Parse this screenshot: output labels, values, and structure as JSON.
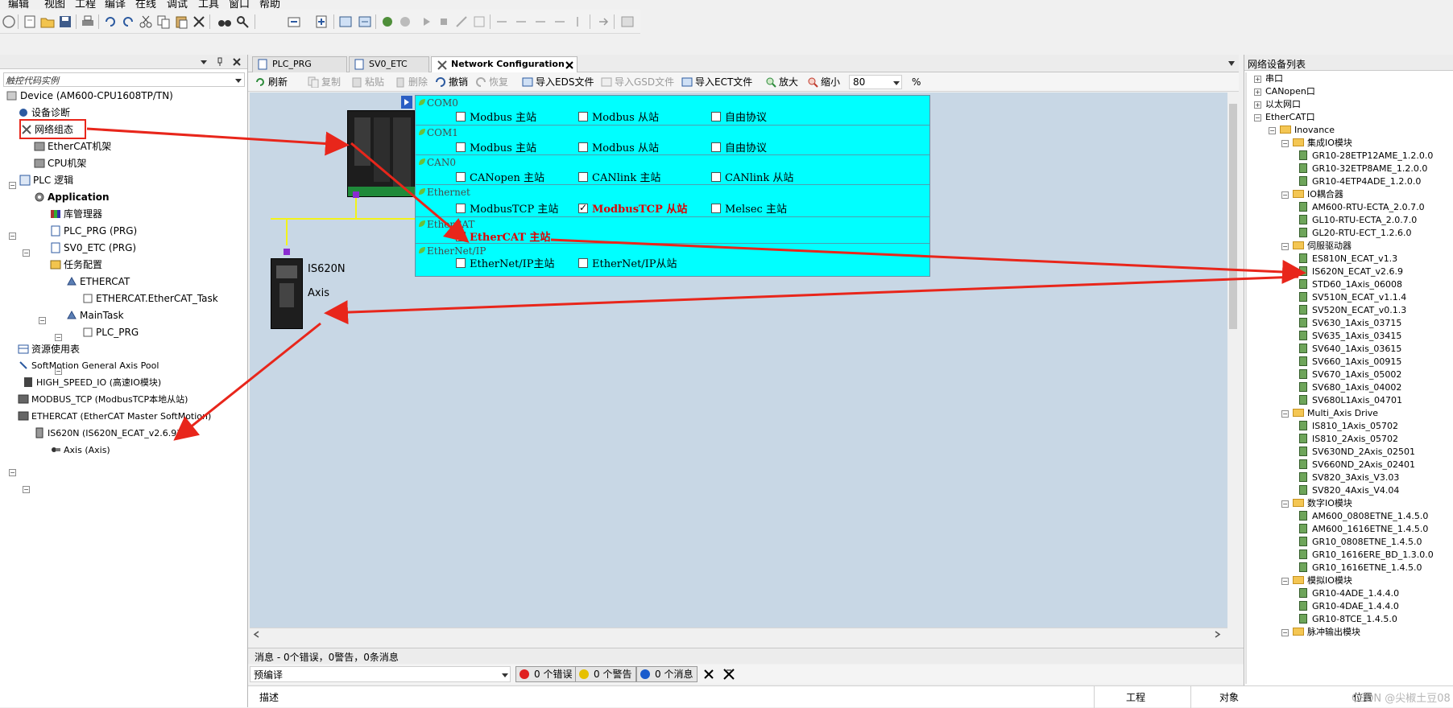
{
  "menu": [
    "编辑",
    "视图",
    "工程",
    "编译",
    "在线",
    "调试",
    "工具",
    "窗口",
    "帮助"
  ],
  "left_panel": {
    "title": "触控代码实例",
    "tree": [
      {
        "label": "Device (AM600-CPU1608TP/TN)"
      },
      {
        "label": "设备诊断"
      },
      {
        "label": "网络组态"
      },
      {
        "label": "EtherCAT机架"
      },
      {
        "label": "CPU机架"
      },
      {
        "label": "PLC 逻辑"
      },
      {
        "label": "Application"
      },
      {
        "label": "库管理器"
      },
      {
        "label": "PLC_PRG (PRG)"
      },
      {
        "label": "SV0_ETC (PRG)"
      },
      {
        "label": "任务配置"
      },
      {
        "label": "ETHERCAT"
      },
      {
        "label": "ETHERCAT.EtherCAT_Task"
      },
      {
        "label": "MainTask"
      },
      {
        "label": "PLC_PRG"
      },
      {
        "label": "资源使用表"
      },
      {
        "label": "SoftMotion General Axis Pool"
      },
      {
        "label": "HIGH_SPEED_IO (高速IO模块)"
      },
      {
        "label": "MODBUS_TCP (ModbusTCP本地从站)"
      },
      {
        "label": "ETHERCAT (EtherCAT Master SoftMotion)"
      },
      {
        "label": "IS620N (IS620N_ECAT_v2.6.9)"
      },
      {
        "label": "Axis (Axis)"
      }
    ]
  },
  "tabs": [
    {
      "label": "PLC_PRG"
    },
    {
      "label": "SV0_ETC"
    },
    {
      "label": "Network Configuration"
    }
  ],
  "center_toolbar": {
    "refresh": "刷新",
    "copy": "复制",
    "paste": "粘贴",
    "delete": "删除",
    "undo": "撤销",
    "redo": "恢复",
    "import_eds": "导入EDS文件",
    "import_gsd": "导入GSD文件",
    "import_ect": "导入ECT文件",
    "zoom_in": "放大",
    "zoom_out": "缩小",
    "zoom_value": "80",
    "percent": "%"
  },
  "canvas": {
    "servo_name": "IS620N",
    "servo_axis": "Axis"
  },
  "config": {
    "sections": [
      {
        "name": "COM0",
        "options": [
          {
            "label": "Modbus 主站",
            "checked": false
          },
          {
            "label": "Modbus 从站",
            "checked": false
          },
          {
            "label": "自由协议",
            "checked": false
          }
        ]
      },
      {
        "name": "COM1",
        "options": [
          {
            "label": "Modbus 主站",
            "checked": false
          },
          {
            "label": "Modbus 从站",
            "checked": false
          },
          {
            "label": "自由协议",
            "checked": false
          }
        ]
      },
      {
        "name": "CAN0",
        "options": [
          {
            "label": "CANopen 主站",
            "checked": false
          },
          {
            "label": "CANlink 主站",
            "checked": false
          },
          {
            "label": "CANlink 从站",
            "checked": false
          }
        ]
      },
      {
        "name": "Ethernet",
        "options": [
          {
            "label": "ModbusTCP 主站",
            "checked": false
          },
          {
            "label": "ModbusTCP 从站",
            "checked": true
          },
          {
            "label": "Melsec 主站",
            "checked": false
          }
        ]
      },
      {
        "name": "EtherCAT",
        "options": [
          {
            "label": "EtherCAT 主站",
            "checked": true
          }
        ]
      },
      {
        "name": "EtherNet/IP",
        "options": [
          {
            "label": "EtherNet/IP主站",
            "checked": false
          },
          {
            "label": "EtherNet/IP从站",
            "checked": false
          }
        ]
      }
    ]
  },
  "right_panel": {
    "title": "网络设备列表",
    "tree": [
      "串口",
      "CANopen口",
      "以太网口",
      "EtherCAT口",
      "Inovance",
      "集成IO模块",
      "GR10-28ETP12AME_1.2.0.0",
      "GR10-32ETP8AME_1.2.0.0",
      "GR10-4ETP4ADE_1.2.0.0",
      "IO耦合器",
      "AM600-RTU-ECTA_2.0.7.0",
      "GL10-RTU-ECTA_2.0.7.0",
      "GL20-RTU-ECT_1.2.6.0",
      "伺服驱动器",
      "ES810N_ECAT_v1.3",
      "IS620N_ECAT_v2.6.9",
      "STD60_1Axis_06008",
      "SV510N_ECAT_v1.1.4",
      "SV520N_ECAT_v0.1.3",
      "SV630_1Axis_03715",
      "SV635_1Axis_03415",
      "SV640_1Axis_03615",
      "SV660_1Axis_00915",
      "SV670_1Axis_05002",
      "SV680_1Axis_04002",
      "SV680L1Axis_04701",
      "Multi_Axis Drive",
      "IS810_1Axis_05702",
      "IS810_2Axis_05702",
      "SV630ND_2Axis_02501",
      "SV660ND_2Axis_02401",
      "SV820_3Axis_V3.03",
      "SV820_4Axis_V4.04",
      "数字IO模块",
      "AM600_0808ETNE_1.4.5.0",
      "AM600_1616ETNE_1.4.5.0",
      "GR10_0808ETNE_1.4.5.0",
      "GR10_1616ERE_BD_1.3.0.0",
      "GR10_1616ETNE_1.4.5.0",
      "模拟IO模块",
      "GR10-4ADE_1.4.4.0",
      "GR10-4DAE_1.4.4.0",
      "GR10-8TCE_1.4.5.0",
      "脉冲输出模块"
    ]
  },
  "messages": {
    "summary": "消息 - 0个错误，0警告，0条消息",
    "filter": "预编译",
    "errors": "0 个错误",
    "warnings": "0 个警告",
    "infos": "0 个消息",
    "col_desc": "描述",
    "col_project": "工程",
    "col_object": "对象",
    "col_position": "位置"
  },
  "watermark": "CSDN @尖椒土豆08",
  "colors": {
    "cyan": "#00ffff",
    "canvas": "#c8d7e5",
    "arrow": "#e8261b",
    "error": "#e02020",
    "warning": "#e6c000",
    "info": "#1a5ccc"
  }
}
